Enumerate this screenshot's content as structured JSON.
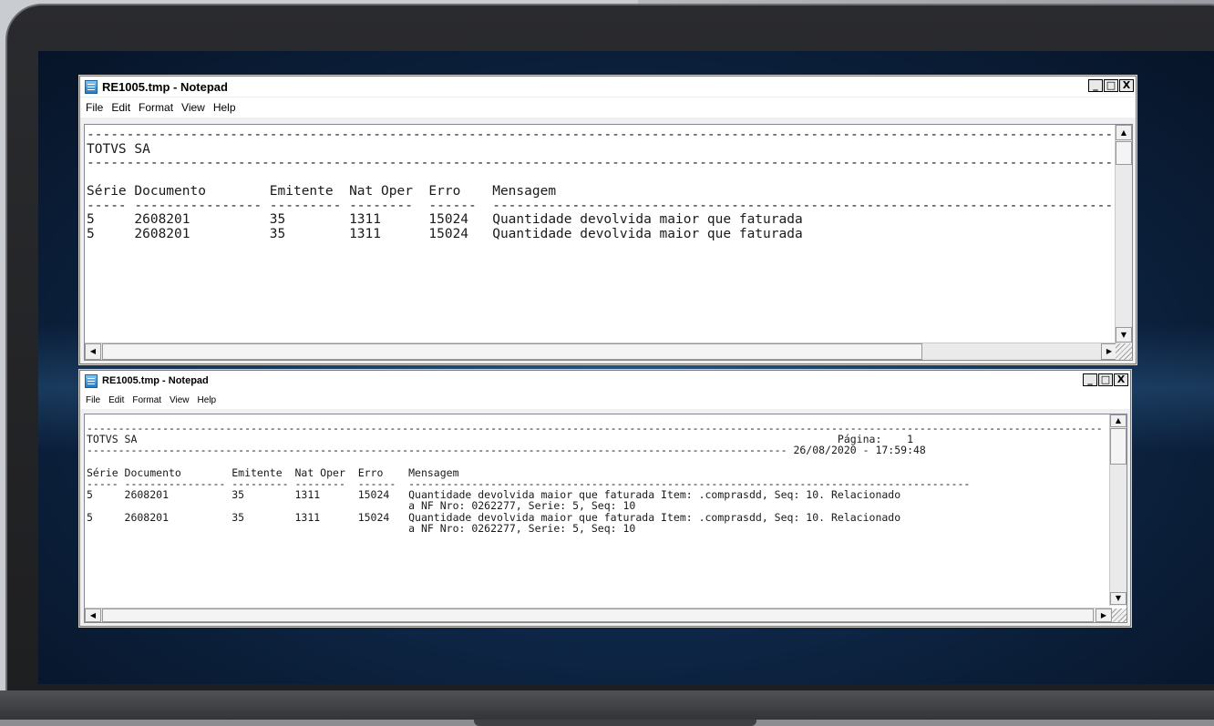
{
  "window1": {
    "title": "RE1005.tmp - Notepad",
    "menu": [
      "File",
      "Edit",
      "Format",
      "View",
      "Help"
    ],
    "content": "----------------------------------------------------------------------------------------------------------------------------------------------------------------\nTOTVS SA\n----------------------------------------------------------------------------------------------------------------------------------------------------------------\n\nSérie Documento        Emitente  Nat Oper  Erro    Mensagem\n----- ---------------- --------- --------  ------  ---------------------------------------------------------------------------------------\n5     2608201          35        1311      15024   Quantidade devolvida maior que faturada\n5     2608201          35        1311      15024   Quantidade devolvida maior que faturada"
  },
  "window2": {
    "title": "RE1005.tmp - Notepad",
    "menu": [
      "File",
      "Edit",
      "Format",
      "View",
      "Help"
    ],
    "content": "-----------------------------------------------------------------------------------------------------------------------------------------------------------------\nTOTVS SA                                                                                                               Página:    1\n--------------------------------------------------------------------------------------------------------------- 26/08/2020 - 17:59:48\n\nSérie Documento        Emitente  Nat Oper  Erro    Mensagem\n----- ---------------- --------- --------  ------  -----------------------------------------------------------------------------------------\n5     2608201          35        1311      15024   Quantidade devolvida maior que faturada Item: .comprasdd, Seq: 10. Relacionado\n                                                   a NF Nro: 0262277, Serie: 5, Seq: 10\n5     2608201          35        1311      15024   Quantidade devolvida maior que faturada Item: .comprasdd, Seq: 10. Relacionado\n                                                   a NF Nro: 0262277, Serie: 5, Seq: 10"
  },
  "controls": {
    "minimize": "_",
    "maximize": "□",
    "close": "X",
    "up": "▲",
    "down": "▼",
    "left": "◀",
    "right": "▶"
  }
}
